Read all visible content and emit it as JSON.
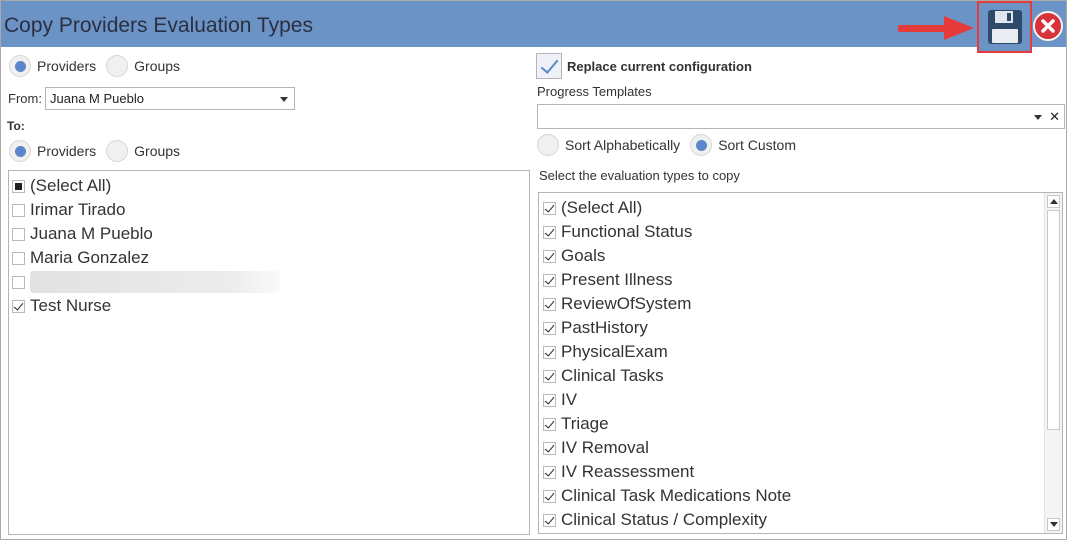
{
  "window": {
    "title": "Copy Providers Evaluation Types"
  },
  "source": {
    "radio_providers": "Providers",
    "radio_groups": "Groups",
    "from_label": "From:",
    "from_value": "Juana M Pueblo"
  },
  "target": {
    "to_label": "To:",
    "radio_providers": "Providers",
    "radio_groups": "Groups",
    "items": [
      {
        "label": "(Select All)",
        "state": "partial"
      },
      {
        "label": "Irimar Tirado",
        "state": "unchecked"
      },
      {
        "label": "Juana M Pueblo",
        "state": "unchecked"
      },
      {
        "label": "Maria Gonzalez",
        "state": "unchecked"
      },
      {
        "label": "",
        "state": "unchecked"
      },
      {
        "label": "Test Nurse",
        "state": "checked"
      }
    ]
  },
  "config": {
    "replace_label": "Replace current configuration",
    "replace_checked": true,
    "templates_label": "Progress Templates",
    "templates_value": "",
    "clear_glyph": "✕",
    "sort_alpha": "Sort Alphabetically",
    "sort_custom": "Sort Custom",
    "eval_label": "Select the evaluation types to copy",
    "eval_items": [
      "(Select All)",
      "Functional Status",
      "Goals",
      "Present Illness",
      "ReviewOfSystem",
      "PastHistory",
      "PhysicalExam",
      "Clinical Tasks",
      "IV",
      "Triage",
      "IV Removal",
      "IV Reassessment",
      "Clinical Task Medications Note",
      "Clinical Status / Complexity"
    ]
  },
  "colors": {
    "titlebar": "#6c93c6",
    "accent": "#5b86c9",
    "close": "#d8323a",
    "highlight": "#e53b3b"
  },
  "icons": {
    "save": "floppy-disk-icon",
    "close": "close-icon",
    "arrow": "red-arrow-icon"
  }
}
